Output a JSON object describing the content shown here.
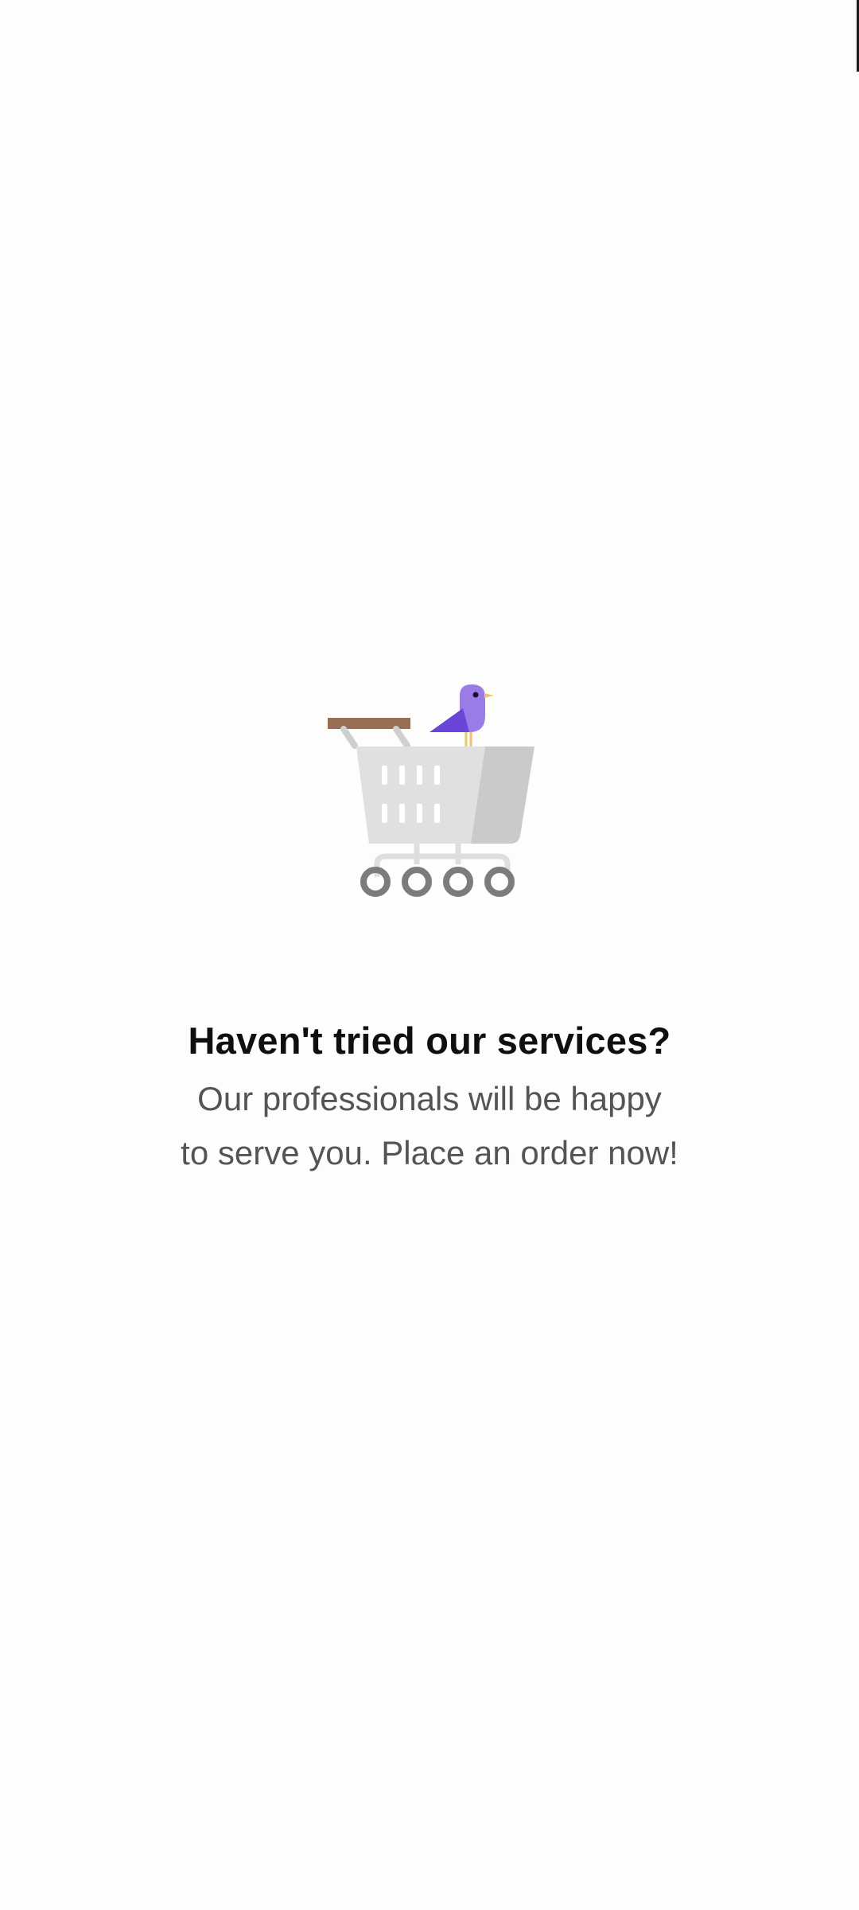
{
  "empty_state": {
    "illustration_icon": "shopping-cart-with-bird",
    "title": "Haven't tried our services?",
    "subtitle_line1": "Our professionals will be happy",
    "subtitle_line2": "to serve you. Place an order now!"
  },
  "colors": {
    "background": "#fdfdfc",
    "title": "#0f0f0f",
    "subtitle": "#545454",
    "bird": "#9b7be6",
    "handle": "#9a6e55",
    "cart": "#e0e0e0"
  }
}
